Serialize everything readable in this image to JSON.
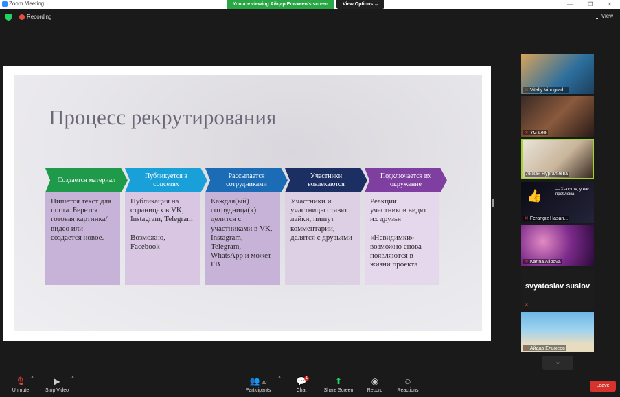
{
  "window": {
    "title": "Zoom Meeting",
    "share_banner": "You are viewing Айдар Ельжеев's screen",
    "view_options": "View Options ⌄"
  },
  "topbar": {
    "recording_label": "Recording",
    "view_label": "View"
  },
  "slide": {
    "title": "Процесс рекрутирования",
    "steps": [
      {
        "heading": "Создается материал",
        "body": "Пишется текст для поста. Берется готовая картинка/видео или создается новое.",
        "color": "#1e9a4a"
      },
      {
        "heading": "Публикуется в соцсетях",
        "body": "Публикация на страницах в VK, Instagram, Telegram\n\nВозможно, Facebook",
        "color": "#1aa0d8"
      },
      {
        "heading": "Рассылается сотрудниками",
        "body": "Каждая(ый) сотрудница(к) делится с участниками в VK, Instagram, Telegram, WhatsApp и может FB",
        "color": "#1b6bb5"
      },
      {
        "heading": "Участники вовлекаются",
        "body": "Участники и участницы ставят лайки, пишут комментарии, делятся с друзьями",
        "color": "#1c2f63"
      },
      {
        "heading": "Подключается их окружение",
        "body": "Реакции участников видят их друзья\n\n«Невидимки» возможно снова появляются в жизни проекта",
        "color": "#7f3fa0"
      }
    ]
  },
  "participants": [
    {
      "name": "Vitaliy Vinograd...",
      "muted": true
    },
    {
      "name": "YG Lee",
      "muted": true
    },
    {
      "name": "Айжан Нургалиева",
      "muted": false
    },
    {
      "name": "Ferangiz Hasan...",
      "muted": true
    },
    {
      "name": "Karina Alipova",
      "muted": true
    },
    {
      "name": "svyatoslav suslov",
      "muted": true
    },
    {
      "name": "Айдар Ельжеев",
      "muted": true
    }
  ],
  "tile_overlay_text": "— Хьюстон, у нас проблема",
  "toolbar": {
    "unmute": "Unmute",
    "stop_video": "Stop Video",
    "participants": "Participants",
    "participants_count": "20",
    "chat": "Chat",
    "chat_badge": "1",
    "share_screen": "Share Screen",
    "record": "Record",
    "reactions": "Reactions",
    "leave": "Leave"
  },
  "colors": {
    "share_banner": "#29a745",
    "leave": "#d6332d",
    "active_speaker": "#9fd62e",
    "card_bg_1": "#c8b3d8",
    "card_bg_2": "#d9c6e3"
  }
}
